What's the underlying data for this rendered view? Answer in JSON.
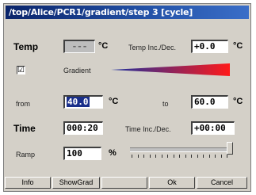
{
  "title": "/top/Alice/PCR1/gradient/step 3 [cycle]",
  "temp": {
    "label": "Temp",
    "value": "---",
    "unit": "°C",
    "inc_label": "Temp Inc./Dec.",
    "inc_value": "+0.0",
    "inc_unit": "°C"
  },
  "gradient": {
    "label": "Gradient",
    "checked": true,
    "check_mark": "☑"
  },
  "range": {
    "from_label": "from",
    "from_value": "40.0",
    "from_unit": "°C",
    "to_label": "to",
    "to_value": "60.0",
    "to_unit": "°C"
  },
  "time": {
    "label": "Time",
    "value": "000:20",
    "inc_label": "Time Inc./Dec.",
    "inc_value": "+00:00"
  },
  "ramp": {
    "label": "Ramp",
    "value": "100",
    "unit": "%",
    "slider_level": 1.0
  },
  "buttons": {
    "info": "Info",
    "showgrad": "ShowGrad",
    "blank": "",
    "ok": "Ok",
    "cancel": "Cancel"
  },
  "colors": {
    "title_bg": "#0a246a",
    "gradient_start": "#1a2fa0",
    "gradient_end": "#ff1a1a"
  }
}
